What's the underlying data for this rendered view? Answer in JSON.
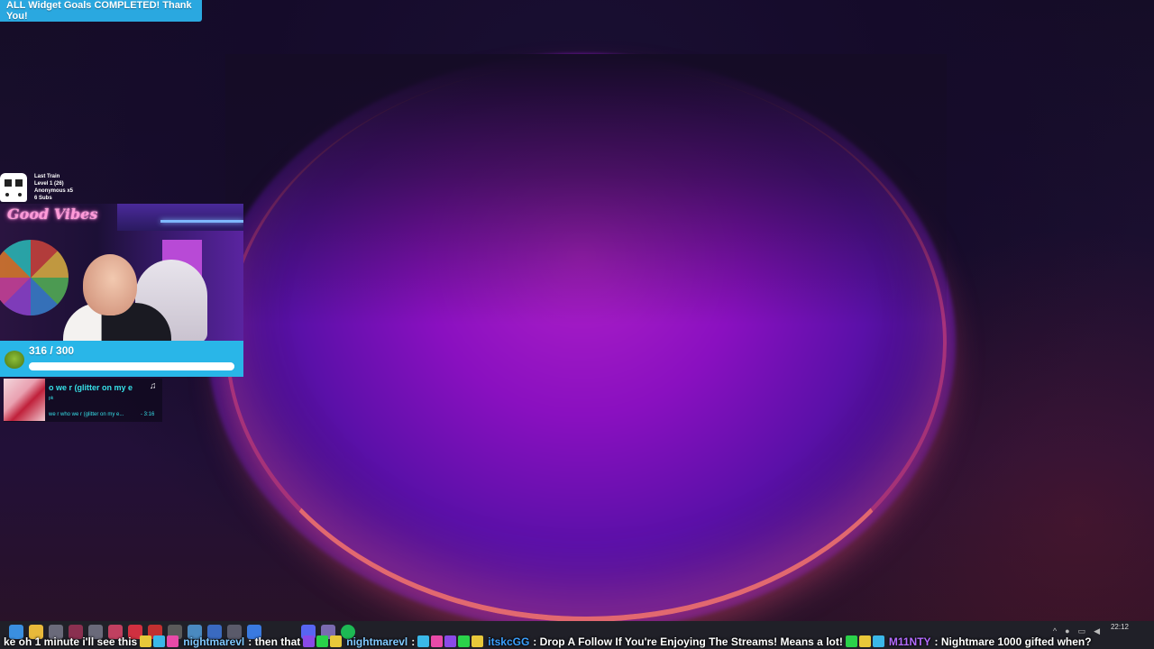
{
  "goal_banner": {
    "text": "ALL Widget Goals COMPLETED! Thank You!"
  },
  "train": {
    "title": "Last Train",
    "level": "Level 1  (26)",
    "latest": "Anonymous x5",
    "subs": "6 Subs"
  },
  "webcam": {
    "neon_sign": "Good Vibes"
  },
  "sub_goal": {
    "count_text": "316 / 300",
    "progress": 1.0
  },
  "now_playing": {
    "title": "o we r (glitter on my e",
    "artist": "pk",
    "line": "we r who we r (glitter on my e...",
    "time": "- 3:16"
  },
  "taskbar": {
    "time": "22:12",
    "icons": [
      "windows-start-icon",
      "folder-icon",
      "chrome-icon",
      "obs-icon",
      "settings-icon",
      "app-icon-1",
      "app-icon-2",
      "app-icon-3",
      "app-icon-4",
      "app-icon-5",
      "app-icon-6",
      "app-icon-7",
      "app-icon-8",
      "discord-icon",
      "app-icon-9",
      "spotify-icon"
    ]
  },
  "ticker": {
    "segments": [
      {
        "type": "text",
        "text": "ke oh 1 minute i'll see this"
      },
      {
        "type": "emotes",
        "count": 3
      },
      {
        "type": "user",
        "text": "nightmarevl",
        "color": "#7fc8ff"
      },
      {
        "type": "text",
        "text": ": then that"
      },
      {
        "type": "emotes",
        "count": 3
      },
      {
        "type": "user",
        "text": "nightmarevl",
        "color": "#7fc8ff"
      },
      {
        "type": "text",
        "text": ":"
      },
      {
        "type": "emotes",
        "count": 5
      },
      {
        "type": "user",
        "text": "itskcGG",
        "color": "#3aa0ff"
      },
      {
        "type": "text",
        "text": ": Drop A Follow If You're Enjoying The Streams! Means a lot!"
      },
      {
        "type": "emotes",
        "count": 3
      },
      {
        "type": "user",
        "text": "M11NTY",
        "color": "#b46cff"
      },
      {
        "type": "text",
        "text": ": Nightmare 1000 gifted when?"
      }
    ]
  }
}
